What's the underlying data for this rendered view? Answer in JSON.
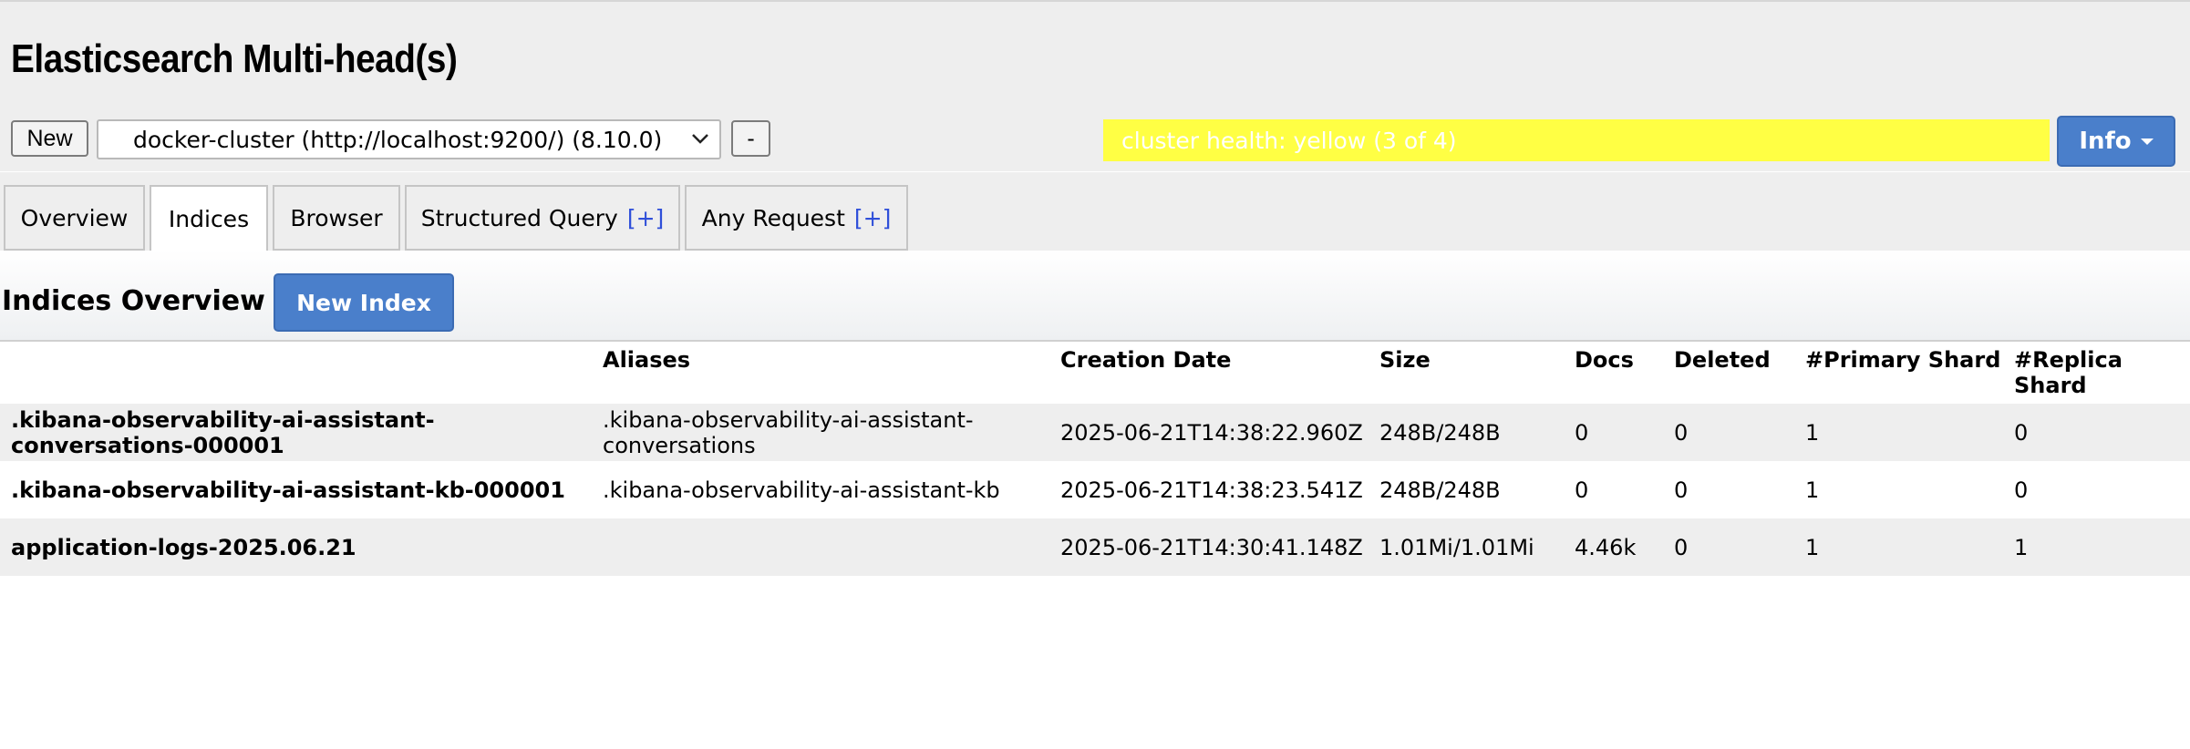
{
  "app": {
    "title": "Elasticsearch Multi-head(s)"
  },
  "toolbar": {
    "new_label": "New",
    "cluster_select_value": "docker-cluster (http://localhost:9200/) (8.10.0)",
    "remove_label": "-",
    "health_text": "cluster health: yellow (3 of 4)",
    "health_color": "#ffff44",
    "info_label": "Info"
  },
  "tabs": [
    {
      "label": "Overview",
      "plus": ""
    },
    {
      "label": "Indices",
      "plus": "",
      "active": true
    },
    {
      "label": "Browser",
      "plus": ""
    },
    {
      "label": "Structured Query",
      "plus": "[+]"
    },
    {
      "label": "Any Request",
      "plus": "[+]"
    }
  ],
  "indices": {
    "title": "Indices Overview",
    "new_index_label": "New Index",
    "columns": [
      "",
      "Aliases",
      "Creation Date",
      "Size",
      "Docs",
      "Deleted",
      "#Primary Shard",
      "#Replica Shard"
    ],
    "rows": [
      {
        "name": ".kibana-observability-ai-assistant-conversations-000001",
        "aliases": ".kibana-observability-ai-assistant-conversations",
        "creation_date": "2025-06-21T14:38:22.960Z",
        "size": "248B/248B",
        "docs": "0",
        "deleted": "0",
        "primary": "1",
        "replica": "0"
      },
      {
        "name": ".kibana-observability-ai-assistant-kb-000001",
        "aliases": ".kibana-observability-ai-assistant-kb",
        "creation_date": "2025-06-21T14:38:23.541Z",
        "size": "248B/248B",
        "docs": "0",
        "deleted": "0",
        "primary": "1",
        "replica": "0"
      },
      {
        "name": "application-logs-2025.06.21",
        "aliases": "",
        "creation_date": "2025-06-21T14:30:41.148Z",
        "size": "1.01Mi/1.01Mi",
        "docs": "4.46k",
        "deleted": "0",
        "primary": "1",
        "replica": "1"
      }
    ]
  },
  "colors": {
    "accent": "#4a7fcb",
    "plus_link": "#2f4fd9",
    "background": "#eeeeee"
  }
}
